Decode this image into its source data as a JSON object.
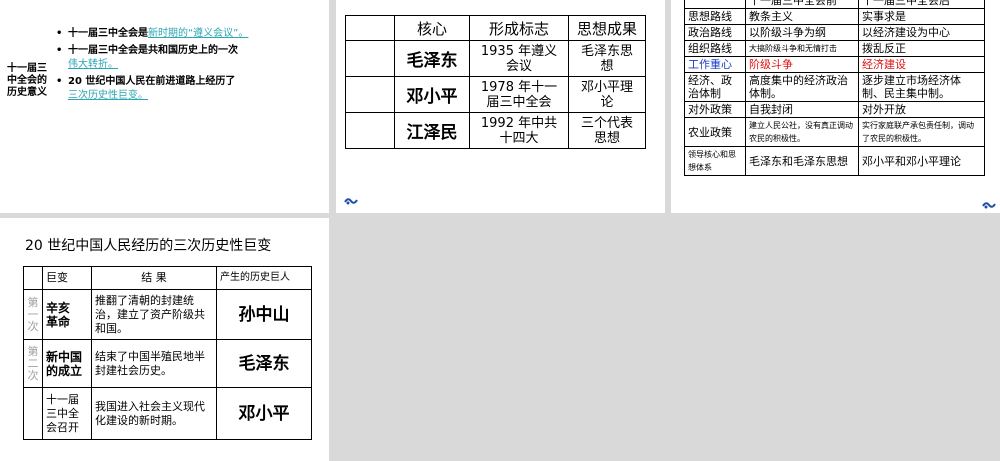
{
  "slide1": {
    "side_label": [
      "十一届三",
      "中全会的",
      "历史意义"
    ],
    "bullets": [
      {
        "text": "十一届三中全会是",
        "highlight": "新时期的“遵义会议”",
        "tail": "。"
      },
      {
        "text": "十一届三中全会是共和国历史上的一次",
        "highlight": "伟大转折",
        "tail": "。"
      },
      {
        "text": "20 世纪中国人民在前进道路上经历了",
        "highlight": "三次历史性巨变",
        "tail": "。"
      }
    ]
  },
  "slide2": {
    "headers": [
      "核心",
      "形成标志",
      "思想成果"
    ],
    "rows": [
      {
        "name": "毛泽东",
        "mark": [
          "1935 年遵义",
          "会议"
        ],
        "result": [
          "毛泽东思",
          "想"
        ]
      },
      {
        "name": "邓小平",
        "mark": [
          "1978 年十一",
          "届三中全会"
        ],
        "result": [
          "邓小平理",
          "论"
        ]
      },
      {
        "name": "江泽民",
        "mark": [
          "1992 年中共",
          "十四大"
        ],
        "result": [
          "三个代表",
          "思想"
        ]
      }
    ]
  },
  "slide3": {
    "headers": [
      "十一届三中全会前",
      "十一届三中全会后"
    ],
    "rows": [
      {
        "label": "思想路线",
        "before": "教条主义",
        "after": "实事求是"
      },
      {
        "label": "政治路线",
        "before": "以阶级斗争为纲",
        "after": "以经济建设为中心"
      },
      {
        "label": "组织路线",
        "before": "大搞阶级斗争和无情打击",
        "after": "拨乱反正"
      },
      {
        "label": "工作重心",
        "before": "阶级斗争",
        "after": "经济建设"
      },
      {
        "label": "经济、政治体制",
        "before": "高度集中的经济政治体制。",
        "after": "逐步建立市场经济体制、民主集中制。"
      },
      {
        "label": "对外政策",
        "before": "自我封闭",
        "after": "对外开放"
      },
      {
        "label": "农业政策",
        "before": "建立人民公社，没有真正调动农民的积极性。",
        "after": "实行家庭联产承包责任制，调动了农民的积极性。"
      },
      {
        "label": "领导核心和思想体系",
        "before": "毛泽东和毛泽东思想",
        "after": "邓小平和邓小平理论"
      }
    ],
    "colors": {
      "label_blue": "#1a3cc9",
      "emphasis_red": "#e01010"
    }
  },
  "slide4": {
    "title": "20 世纪中国人民经历的三次历史性巨变",
    "headers": [
      "巨变",
      "结    果",
      "产生的历史巨人"
    ],
    "rows": [
      {
        "order": [
          "第",
          "一",
          "次"
        ],
        "event": [
          "辛亥",
          "革命"
        ],
        "result": "推翻了清朝的封建统治，建立了资产阶级共和国。",
        "person": "孙中山"
      },
      {
        "order": [
          "第",
          "二",
          "次"
        ],
        "event": [
          "新中国",
          "的成立"
        ],
        "result": "结束了中国半殖民地半封建社会历史。",
        "person": "毛泽东"
      },
      {
        "order": [],
        "event": [
          "十一届",
          "三中全",
          "会召开"
        ],
        "result": "我国进入社会主义现代化建设的新时期。",
        "person": "邓小平"
      }
    ]
  },
  "icons": {
    "nav": "swirl-nav-icon"
  },
  "colors": {
    "highlight": "#2aa7b2",
    "nav_icon": "#1f4fa8"
  }
}
